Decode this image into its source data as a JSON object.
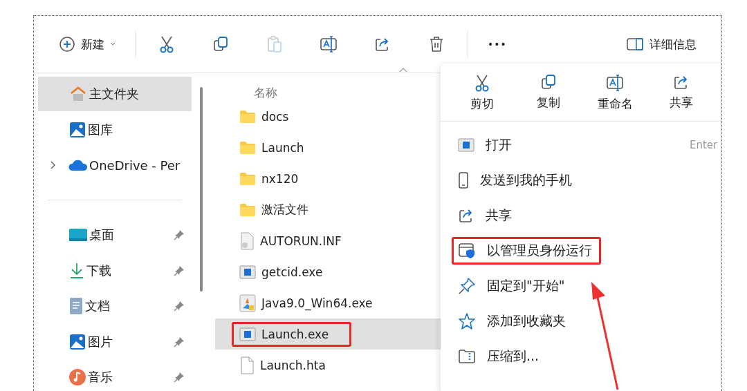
{
  "toolbar": [
    {
      "kind": "new",
      "label": "新建",
      "disabled": false
    },
    {
      "kind": "cut",
      "disabled": false
    },
    {
      "kind": "copy",
      "disabled": false
    },
    {
      "kind": "paste",
      "disabled": true
    },
    {
      "kind": "rename",
      "disabled": false
    },
    {
      "kind": "share",
      "disabled": false
    },
    {
      "kind": "delete",
      "disabled": false
    },
    {
      "kind": "more",
      "label": "•••",
      "disabled": false
    },
    {
      "kind": "details",
      "label": "详细信息",
      "disabled": false
    }
  ],
  "sidebar": {
    "items": [
      {
        "kind": "home",
        "label": "主文件夹",
        "selected": true,
        "pinned": false,
        "expandable": false
      },
      {
        "kind": "gallery",
        "label": "图库",
        "selected": false,
        "pinned": false,
        "expandable": false
      },
      {
        "kind": "cloud",
        "label": "OneDrive - Per",
        "selected": false,
        "pinned": false,
        "expandable": true
      },
      {
        "kind": "divider"
      },
      {
        "kind": "desktop",
        "label": "桌面",
        "selected": false,
        "pinned": true,
        "expandable": false
      },
      {
        "kind": "download",
        "label": "下载",
        "selected": false,
        "pinned": true,
        "expandable": false
      },
      {
        "kind": "document",
        "label": "文档",
        "selected": false,
        "pinned": true,
        "expandable": false
      },
      {
        "kind": "gallery",
        "label": "图片",
        "selected": false,
        "pinned": true,
        "expandable": false
      },
      {
        "kind": "music",
        "label": "音乐",
        "selected": false,
        "pinned": true,
        "expandable": false
      }
    ]
  },
  "file_list": {
    "column": "名称",
    "files": [
      {
        "kind": "folder",
        "name": "docs",
        "selected": false,
        "highlighted": false
      },
      {
        "kind": "folder",
        "name": "Launch",
        "selected": false,
        "highlighted": false
      },
      {
        "kind": "folder",
        "name": "nx120",
        "selected": false,
        "highlighted": false
      },
      {
        "kind": "folder",
        "name": "激活文件",
        "selected": false,
        "highlighted": false
      },
      {
        "kind": "settings",
        "name": "AUTORUN.INF",
        "selected": false,
        "highlighted": false
      },
      {
        "kind": "app",
        "name": "getcid.exe",
        "selected": false,
        "highlighted": false
      },
      {
        "kind": "installer",
        "name": "Java9.0_Win64.exe",
        "selected": false,
        "highlighted": false
      },
      {
        "kind": "app",
        "name": "Launch.exe",
        "selected": true,
        "highlighted": true
      },
      {
        "kind": "file",
        "name": "Launch.hta",
        "selected": false,
        "highlighted": false
      }
    ]
  },
  "context_menu": {
    "quick_actions": [
      {
        "kind": "cut",
        "label": "剪切"
      },
      {
        "kind": "copy",
        "label": "复制"
      },
      {
        "kind": "rename",
        "label": "重命名"
      },
      {
        "kind": "share",
        "label": "共享"
      }
    ],
    "items": [
      {
        "kind": "app",
        "label": "打开",
        "shortcut": "Enter",
        "highlighted": false
      },
      {
        "kind": "phone",
        "label": "发送到我的手机",
        "highlighted": false
      },
      {
        "kind": "share",
        "label": "共享",
        "highlighted": false
      },
      {
        "kind": "admin",
        "label": "以管理员身份运行",
        "highlighted": true
      },
      {
        "kind": "pin",
        "label": "固定到\"开始\"",
        "highlighted": false
      },
      {
        "kind": "star",
        "label": "添加到收藏夹",
        "highlighted": false
      },
      {
        "kind": "zip",
        "label": "压缩到...",
        "highlighted": false
      }
    ]
  }
}
